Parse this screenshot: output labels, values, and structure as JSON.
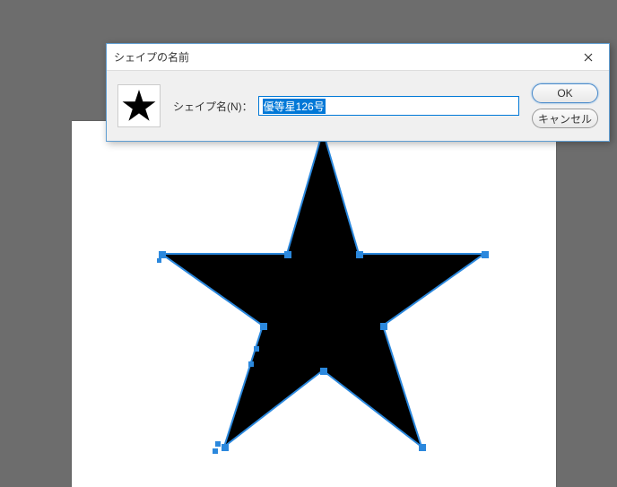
{
  "dialog": {
    "title": "シェイプの名前",
    "label": "シェイプ名(N)：",
    "input_value": "優等星126号",
    "ok_label": "OK",
    "cancel_label": "キャンセル"
  }
}
